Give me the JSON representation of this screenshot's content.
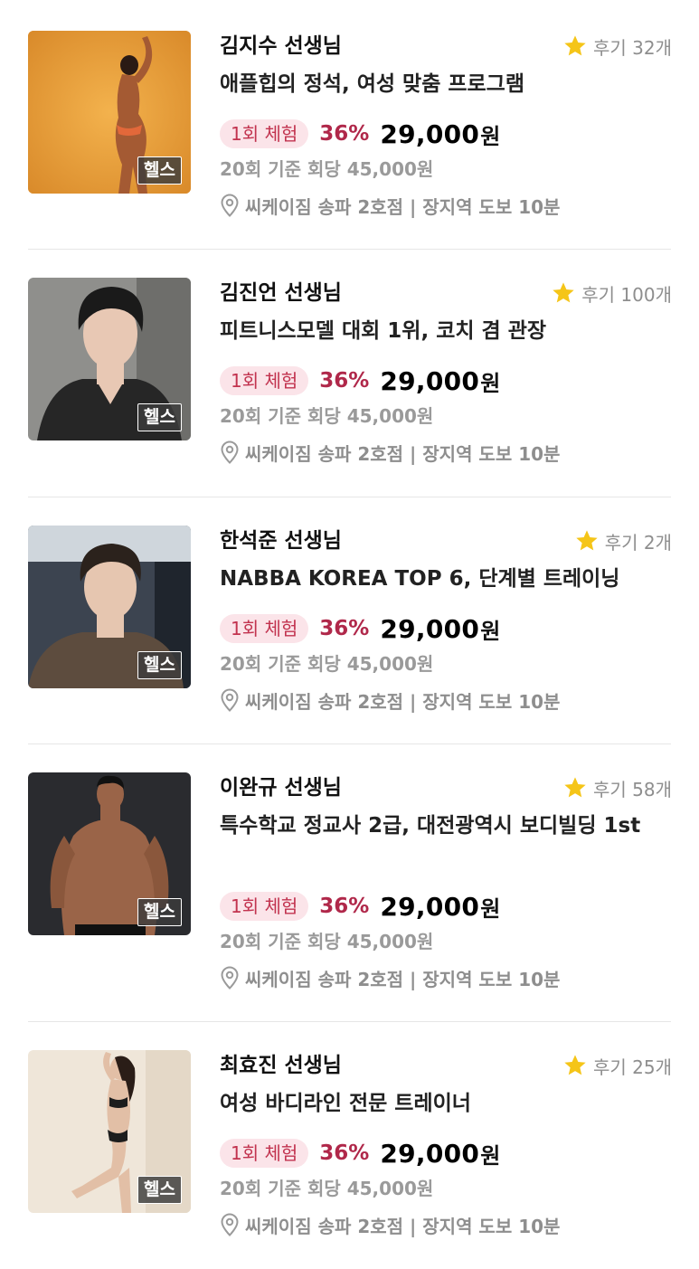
{
  "trainers": [
    {
      "name": "김지수 선생님",
      "reviews": "후기 32개",
      "title": "애플힙의 정석, 여성 맞춤 프로그램",
      "trial": "1회 체험",
      "discount": "36%",
      "price": "29,000",
      "currency": "원",
      "base": "20회 기준 회당 45,000원",
      "location": "씨케이짐 송파 2호점 | 장지역 도보 10분",
      "category": "헬스",
      "photo": {
        "bg": "#e9a03d",
        "subject": "woman-back-pose",
        "tone": "#a45a33"
      }
    },
    {
      "name": "김진언 선생님",
      "reviews": "후기 100개",
      "title": "피트니스모델 대회 1위, 코치 겸 관장",
      "trial": "1회 체험",
      "discount": "36%",
      "price": "29,000",
      "currency": "원",
      "base": "20회 기준 회당 45,000원",
      "location": "씨케이짐 송파 2호점 | 장지역 도보 10분",
      "category": "헬스",
      "photo": {
        "bg": "#8f8f8c",
        "subject": "man-portrait",
        "tone": "#e8c8b4"
      }
    },
    {
      "name": "한석준 선생님",
      "reviews": "후기 2개",
      "title": "NABBA KOREA TOP 6, 단계별 트레이닝",
      "trial": "1회 체험",
      "discount": "36%",
      "price": "29,000",
      "currency": "원",
      "base": "20회 기준 회당 45,000원",
      "location": "씨케이짐 송파 2호점 | 장지역 도보 10분",
      "category": "헬스",
      "photo": {
        "bg": "#3c4450",
        "subject": "man-in-car",
        "tone": "#e6c6b0"
      }
    },
    {
      "name": "이완규 선생님",
      "reviews": "후기 58개",
      "title": "특수학교 정교사 2급, 대전광역시 보디빌딩 1st",
      "trial": "1회 체험",
      "discount": "36%",
      "price": "29,000",
      "currency": "원",
      "base": "20회 기준 회당 45,000원",
      "location": "씨케이짐 송파 2호점 | 장지역 도보 10분",
      "category": "헬스",
      "photo": {
        "bg": "#2a2b2f",
        "subject": "man-shirtless",
        "tone": "#9a6448"
      }
    },
    {
      "name": "최효진 선생님",
      "reviews": "후기 25개",
      "title": "여성 바디라인 전문 트레이너",
      "trial": "1회 체험",
      "discount": "36%",
      "price": "29,000",
      "currency": "원",
      "base": "20회 기준 회당 45,000원",
      "location": "씨케이짐 송파 2호점 | 장지역 도보 10분",
      "category": "헬스",
      "photo": {
        "bg": "#efe6d9",
        "subject": "woman-pose",
        "tone": "#e2bfa6"
      }
    }
  ],
  "colors": {
    "star": "#f5c518",
    "trial_bg": "#fbe4e9",
    "trial_text": "#c2334f",
    "discount": "#b0284a"
  }
}
